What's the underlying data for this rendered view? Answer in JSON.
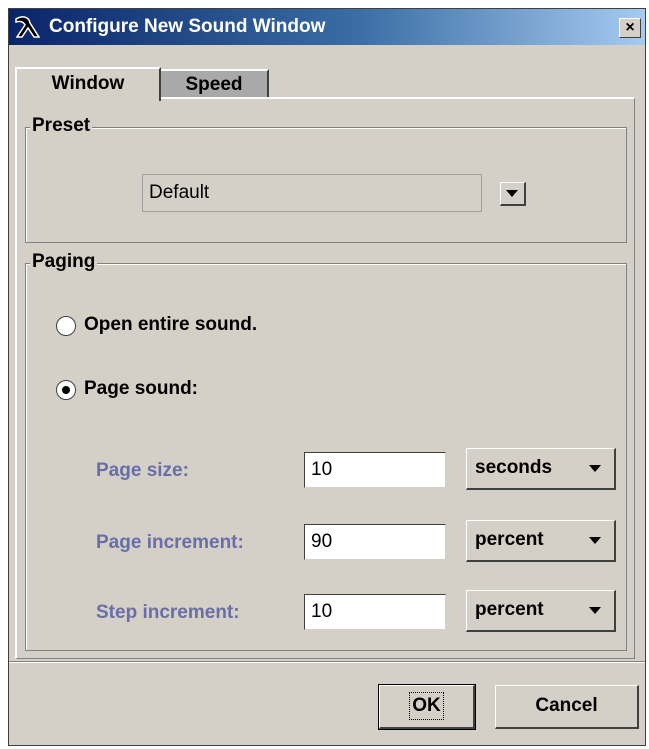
{
  "window": {
    "title": "Configure New Sound Window",
    "close_symbol": "×",
    "icon": "app-logo-icon"
  },
  "tabs": [
    {
      "label": "Window",
      "selected": true
    },
    {
      "label": "Speed",
      "selected": false
    }
  ],
  "preset": {
    "group_title": "Preset",
    "selected_value": "Default"
  },
  "paging": {
    "group_title": "Paging",
    "options": [
      {
        "label": "Open entire sound.",
        "checked": false
      },
      {
        "label": "Page sound:",
        "checked": true
      }
    ],
    "fields": [
      {
        "label": "Page size:",
        "value": "10",
        "unit": "seconds"
      },
      {
        "label": "Page increment:",
        "value": "90",
        "unit": "percent"
      },
      {
        "label": "Step increment:",
        "value": "10",
        "unit": "percent"
      }
    ]
  },
  "buttons": {
    "ok_label": "OK",
    "cancel_label": "Cancel"
  },
  "colors": {
    "title_gradient_start": "#0a246a",
    "title_gradient_end": "#a6caf0",
    "dialog_bg": "#d4d0c8",
    "field_label_color": "#6a6ea8"
  }
}
